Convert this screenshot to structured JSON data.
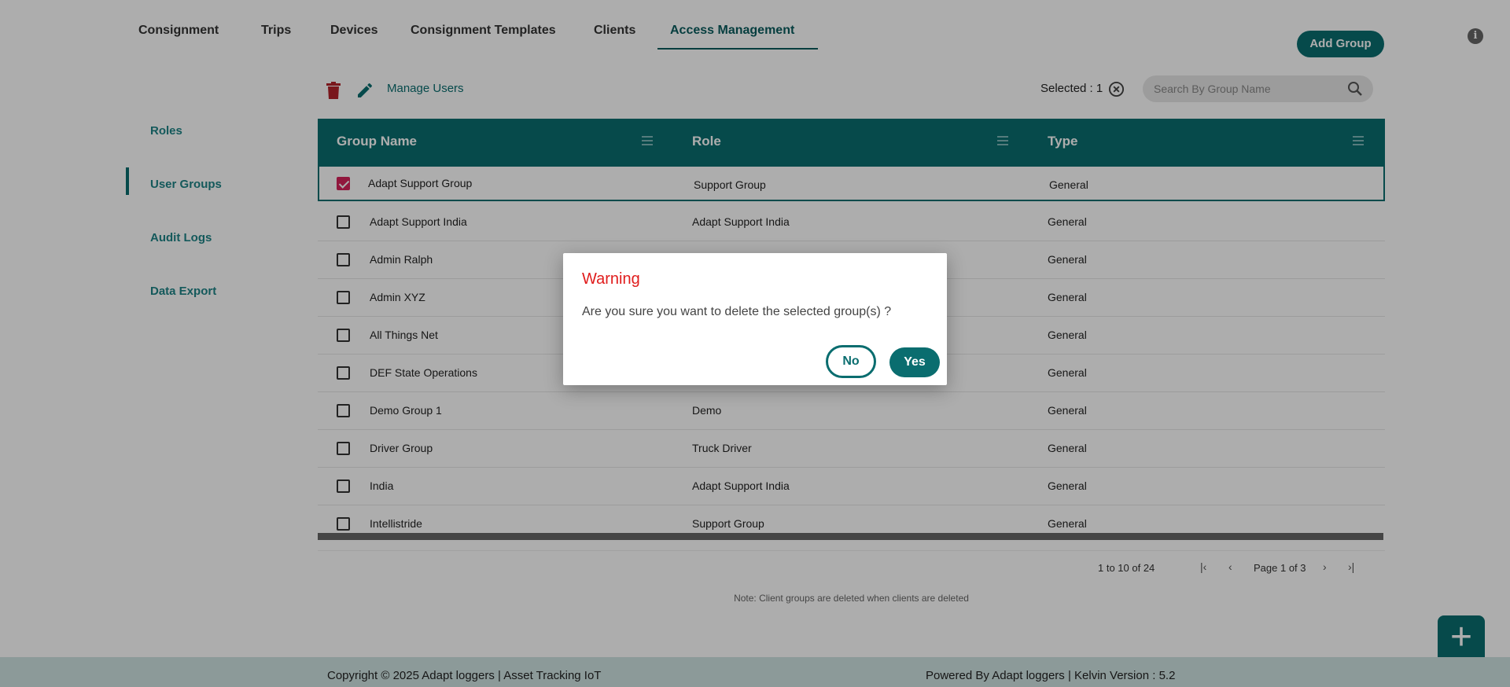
{
  "topnav": {
    "tabs": [
      "Consignment",
      "Trips",
      "Devices",
      "Consignment Templates",
      "Clients",
      "Access Management"
    ],
    "active_tab": "Access Management",
    "add_group_label": "Add Group"
  },
  "sidebar": {
    "items": [
      "Roles",
      "User Groups",
      "Audit Logs",
      "Data Export"
    ],
    "active_item": "User Groups"
  },
  "toolbar": {
    "manage_users_label": "Manage Users",
    "selected_label": "Selected : 1",
    "search_placeholder": "Search By Group Name"
  },
  "table": {
    "columns": [
      "Group Name",
      "Role",
      "Type"
    ],
    "rows": [
      {
        "group": "Adapt Support Group",
        "role": "Support Group",
        "type": "General",
        "checked": true
      },
      {
        "group": "Adapt Support India",
        "role": "Adapt Support India",
        "type": "General",
        "checked": false
      },
      {
        "group": "Admin Ralph",
        "role": "",
        "type": "General",
        "checked": false
      },
      {
        "group": "Admin XYZ",
        "role": "",
        "type": "General",
        "checked": false
      },
      {
        "group": "All Things Net",
        "role": "",
        "type": "General",
        "checked": false
      },
      {
        "group": "DEF State Operations",
        "role": "",
        "type": "General",
        "checked": false
      },
      {
        "group": "Demo Group 1",
        "role": "Demo",
        "type": "General",
        "checked": false
      },
      {
        "group": "Driver Group",
        "role": "Truck Driver",
        "type": "General",
        "checked": false
      },
      {
        "group": "India",
        "role": "Adapt Support India",
        "type": "General",
        "checked": false
      },
      {
        "group": "Intellistride",
        "role": "Support Group",
        "type": "General",
        "checked": false
      }
    ]
  },
  "pager": {
    "range": "1 to 10 of 24",
    "page_text": "Page 1 of 3"
  },
  "note": "Note: Client groups are deleted when clients are deleted",
  "footer": {
    "left": "Copyright © 2025 Adapt loggers | Asset Tracking IoT",
    "right": "Powered By Adapt loggers | Kelvin Version : 5.2"
  },
  "dialog": {
    "title": "Warning",
    "message": "Are you sure you want to delete the selected group(s) ?",
    "no_label": "No",
    "yes_label": "Yes"
  },
  "colors": {
    "primary": "#0a6d6f",
    "warning_title": "#e01c1c",
    "checkbox_checked": "#d6235a",
    "trash": "#b3222a"
  },
  "icons": [
    "trash-icon",
    "pencil-icon",
    "clear-selection-icon",
    "search-icon",
    "info-icon",
    "column-menu-icon",
    "first-page-icon",
    "prev-page-icon",
    "next-page-icon",
    "last-page-icon",
    "plus-icon"
  ]
}
